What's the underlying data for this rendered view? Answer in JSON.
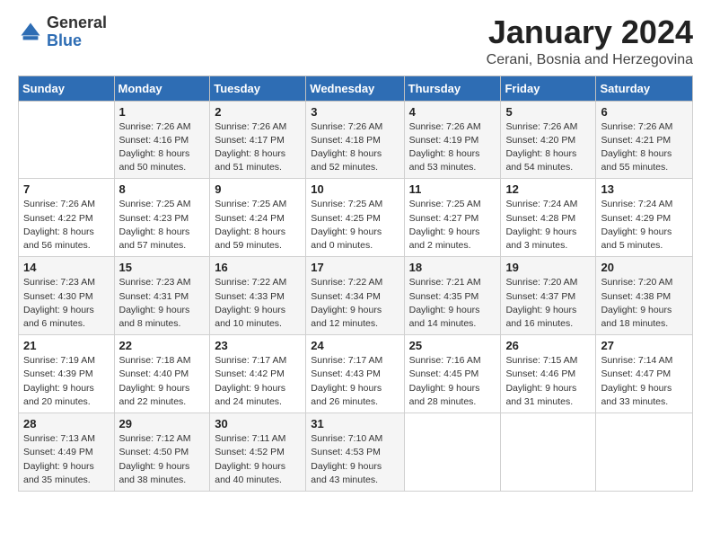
{
  "logo": {
    "general": "General",
    "blue": "Blue"
  },
  "header": {
    "month": "January 2024",
    "location": "Cerani, Bosnia and Herzegovina"
  },
  "days_of_week": [
    "Sunday",
    "Monday",
    "Tuesday",
    "Wednesday",
    "Thursday",
    "Friday",
    "Saturday"
  ],
  "weeks": [
    [
      {
        "day": "",
        "sunrise": "",
        "sunset": "",
        "daylight": ""
      },
      {
        "day": "1",
        "sunrise": "Sunrise: 7:26 AM",
        "sunset": "Sunset: 4:16 PM",
        "daylight": "Daylight: 8 hours and 50 minutes."
      },
      {
        "day": "2",
        "sunrise": "Sunrise: 7:26 AM",
        "sunset": "Sunset: 4:17 PM",
        "daylight": "Daylight: 8 hours and 51 minutes."
      },
      {
        "day": "3",
        "sunrise": "Sunrise: 7:26 AM",
        "sunset": "Sunset: 4:18 PM",
        "daylight": "Daylight: 8 hours and 52 minutes."
      },
      {
        "day": "4",
        "sunrise": "Sunrise: 7:26 AM",
        "sunset": "Sunset: 4:19 PM",
        "daylight": "Daylight: 8 hours and 53 minutes."
      },
      {
        "day": "5",
        "sunrise": "Sunrise: 7:26 AM",
        "sunset": "Sunset: 4:20 PM",
        "daylight": "Daylight: 8 hours and 54 minutes."
      },
      {
        "day": "6",
        "sunrise": "Sunrise: 7:26 AM",
        "sunset": "Sunset: 4:21 PM",
        "daylight": "Daylight: 8 hours and 55 minutes."
      }
    ],
    [
      {
        "day": "7",
        "sunrise": "Sunrise: 7:26 AM",
        "sunset": "Sunset: 4:22 PM",
        "daylight": "Daylight: 8 hours and 56 minutes."
      },
      {
        "day": "8",
        "sunrise": "Sunrise: 7:25 AM",
        "sunset": "Sunset: 4:23 PM",
        "daylight": "Daylight: 8 hours and 57 minutes."
      },
      {
        "day": "9",
        "sunrise": "Sunrise: 7:25 AM",
        "sunset": "Sunset: 4:24 PM",
        "daylight": "Daylight: 8 hours and 59 minutes."
      },
      {
        "day": "10",
        "sunrise": "Sunrise: 7:25 AM",
        "sunset": "Sunset: 4:25 PM",
        "daylight": "Daylight: 9 hours and 0 minutes."
      },
      {
        "day": "11",
        "sunrise": "Sunrise: 7:25 AM",
        "sunset": "Sunset: 4:27 PM",
        "daylight": "Daylight: 9 hours and 2 minutes."
      },
      {
        "day": "12",
        "sunrise": "Sunrise: 7:24 AM",
        "sunset": "Sunset: 4:28 PM",
        "daylight": "Daylight: 9 hours and 3 minutes."
      },
      {
        "day": "13",
        "sunrise": "Sunrise: 7:24 AM",
        "sunset": "Sunset: 4:29 PM",
        "daylight": "Daylight: 9 hours and 5 minutes."
      }
    ],
    [
      {
        "day": "14",
        "sunrise": "Sunrise: 7:23 AM",
        "sunset": "Sunset: 4:30 PM",
        "daylight": "Daylight: 9 hours and 6 minutes."
      },
      {
        "day": "15",
        "sunrise": "Sunrise: 7:23 AM",
        "sunset": "Sunset: 4:31 PM",
        "daylight": "Daylight: 9 hours and 8 minutes."
      },
      {
        "day": "16",
        "sunrise": "Sunrise: 7:22 AM",
        "sunset": "Sunset: 4:33 PM",
        "daylight": "Daylight: 9 hours and 10 minutes."
      },
      {
        "day": "17",
        "sunrise": "Sunrise: 7:22 AM",
        "sunset": "Sunset: 4:34 PM",
        "daylight": "Daylight: 9 hours and 12 minutes."
      },
      {
        "day": "18",
        "sunrise": "Sunrise: 7:21 AM",
        "sunset": "Sunset: 4:35 PM",
        "daylight": "Daylight: 9 hours and 14 minutes."
      },
      {
        "day": "19",
        "sunrise": "Sunrise: 7:20 AM",
        "sunset": "Sunset: 4:37 PM",
        "daylight": "Daylight: 9 hours and 16 minutes."
      },
      {
        "day": "20",
        "sunrise": "Sunrise: 7:20 AM",
        "sunset": "Sunset: 4:38 PM",
        "daylight": "Daylight: 9 hours and 18 minutes."
      }
    ],
    [
      {
        "day": "21",
        "sunrise": "Sunrise: 7:19 AM",
        "sunset": "Sunset: 4:39 PM",
        "daylight": "Daylight: 9 hours and 20 minutes."
      },
      {
        "day": "22",
        "sunrise": "Sunrise: 7:18 AM",
        "sunset": "Sunset: 4:40 PM",
        "daylight": "Daylight: 9 hours and 22 minutes."
      },
      {
        "day": "23",
        "sunrise": "Sunrise: 7:17 AM",
        "sunset": "Sunset: 4:42 PM",
        "daylight": "Daylight: 9 hours and 24 minutes."
      },
      {
        "day": "24",
        "sunrise": "Sunrise: 7:17 AM",
        "sunset": "Sunset: 4:43 PM",
        "daylight": "Daylight: 9 hours and 26 minutes."
      },
      {
        "day": "25",
        "sunrise": "Sunrise: 7:16 AM",
        "sunset": "Sunset: 4:45 PM",
        "daylight": "Daylight: 9 hours and 28 minutes."
      },
      {
        "day": "26",
        "sunrise": "Sunrise: 7:15 AM",
        "sunset": "Sunset: 4:46 PM",
        "daylight": "Daylight: 9 hours and 31 minutes."
      },
      {
        "day": "27",
        "sunrise": "Sunrise: 7:14 AM",
        "sunset": "Sunset: 4:47 PM",
        "daylight": "Daylight: 9 hours and 33 minutes."
      }
    ],
    [
      {
        "day": "28",
        "sunrise": "Sunrise: 7:13 AM",
        "sunset": "Sunset: 4:49 PM",
        "daylight": "Daylight: 9 hours and 35 minutes."
      },
      {
        "day": "29",
        "sunrise": "Sunrise: 7:12 AM",
        "sunset": "Sunset: 4:50 PM",
        "daylight": "Daylight: 9 hours and 38 minutes."
      },
      {
        "day": "30",
        "sunrise": "Sunrise: 7:11 AM",
        "sunset": "Sunset: 4:52 PM",
        "daylight": "Daylight: 9 hours and 40 minutes."
      },
      {
        "day": "31",
        "sunrise": "Sunrise: 7:10 AM",
        "sunset": "Sunset: 4:53 PM",
        "daylight": "Daylight: 9 hours and 43 minutes."
      },
      {
        "day": "",
        "sunrise": "",
        "sunset": "",
        "daylight": ""
      },
      {
        "day": "",
        "sunrise": "",
        "sunset": "",
        "daylight": ""
      },
      {
        "day": "",
        "sunrise": "",
        "sunset": "",
        "daylight": ""
      }
    ]
  ]
}
